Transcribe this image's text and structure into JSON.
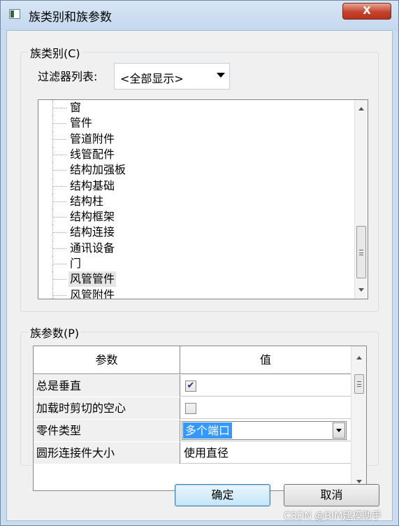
{
  "window": {
    "title": "族类别和族参数",
    "close_label": "X"
  },
  "family_category": {
    "group_title": "族类别(C)",
    "filter_label": "过滤器列表:",
    "filter_value": "<全部显示>",
    "items": [
      {
        "label": "窗"
      },
      {
        "label": "管件"
      },
      {
        "label": "管道附件"
      },
      {
        "label": "线管配件"
      },
      {
        "label": "结构加强板"
      },
      {
        "label": "结构基础"
      },
      {
        "label": "结构柱"
      },
      {
        "label": "结构框架"
      },
      {
        "label": "结构连接"
      },
      {
        "label": "通讯设备"
      },
      {
        "label": "门"
      },
      {
        "label": "风管管件"
      },
      {
        "label": "风管附件"
      }
    ],
    "selected_item": "风管管件"
  },
  "family_parameters": {
    "group_title": "族参数(P)",
    "columns": {
      "param": "参数",
      "value": "值"
    },
    "rows": [
      {
        "name": "总是垂直",
        "value_type": "checkbox",
        "checked": true
      },
      {
        "name": "加载时剪切的空心",
        "value_type": "checkbox",
        "checked": false
      },
      {
        "name": "零件类型",
        "value_type": "combo",
        "value": "多个端口"
      },
      {
        "name": "圆形连接件大小",
        "value_type": "text",
        "value": "使用直径"
      }
    ]
  },
  "buttons": {
    "ok": "确定",
    "cancel": "取消"
  },
  "watermark": "CSDN @BIM建模助手"
}
